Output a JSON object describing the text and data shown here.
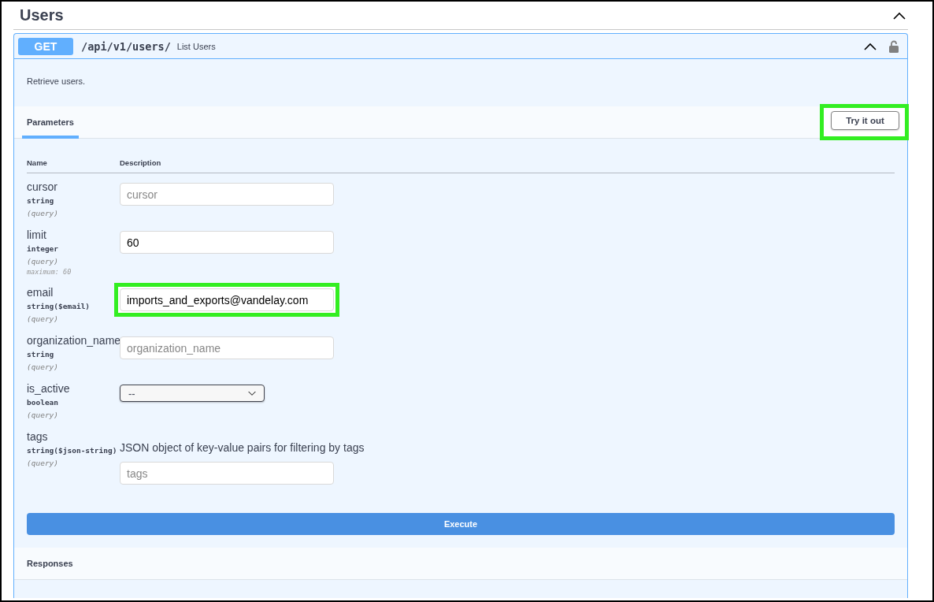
{
  "section": {
    "title": "Users",
    "expanded": true
  },
  "operation": {
    "method": "GET",
    "path": "/api/v1/users/",
    "summary": "List Users",
    "expanded": true,
    "locked": false,
    "description": "Retrieve users."
  },
  "tabs": [
    {
      "label": "Parameters",
      "selected": true
    }
  ],
  "try_button": {
    "label": "Try it out",
    "highlighted": true
  },
  "columns": [
    "Name",
    "Description"
  ],
  "parameters": [
    {
      "name": "cursor",
      "type": "string",
      "in": "(query)",
      "kind": "text",
      "placeholder": "cursor",
      "highlighted": false
    },
    {
      "name": "limit",
      "type": "integer",
      "in": "(query)",
      "extra": "maximum: 60",
      "kind": "text",
      "value": "60",
      "highlighted": false
    },
    {
      "name": "email",
      "type": "string($email)",
      "in": "(query)",
      "kind": "text",
      "value": "imports_and_exports@vandelay.com",
      "highlighted": true
    },
    {
      "name": "organization_name",
      "type": "string",
      "in": "(query)",
      "kind": "text",
      "placeholder": "organization_name",
      "highlighted": false
    },
    {
      "name": "is_active",
      "type": "boolean",
      "in": "(query)",
      "kind": "select",
      "value": "--",
      "highlighted": false
    },
    {
      "name": "tags",
      "type": "string($json-string)",
      "in": "(query)",
      "description": "JSON object of key-value pairs for filtering by tags",
      "kind": "text",
      "placeholder": "tags",
      "highlighted": false
    }
  ],
  "execute_button": "Execute",
  "responses_title": "Responses"
}
